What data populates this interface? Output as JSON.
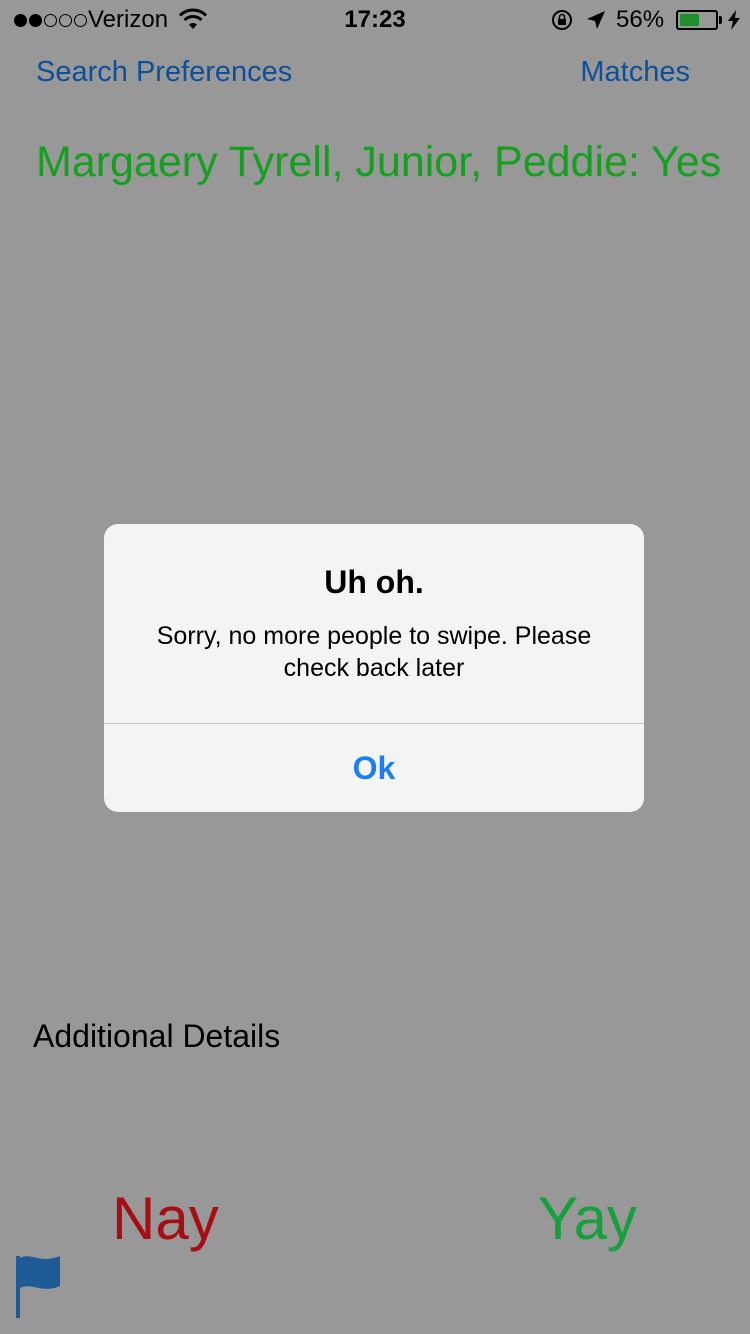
{
  "status_bar": {
    "signal_dots_filled": 2,
    "signal_dots_total": 5,
    "carrier": "Verizon",
    "time": "17:23",
    "battery_percent": "56%",
    "battery_level": 0.56,
    "battery_color": "#1f8f2b"
  },
  "nav": {
    "left_label": "Search Preferences",
    "right_label": "Matches",
    "link_color": "#0c4f9a"
  },
  "profile": {
    "title": "Margaery Tyrell, Junior, Peddie: Yes",
    "title_color": "#14a01e"
  },
  "details": {
    "label": "Additional Details"
  },
  "actions": {
    "nay_label": "Nay",
    "yay_label": "Yay",
    "nay_color": "#a80d13",
    "yay_color": "#14a03a"
  },
  "flag": {
    "icon": "flag-icon",
    "color": "#1e5b96"
  },
  "alert": {
    "title": "Uh oh.",
    "message": "Sorry, no more people to swipe. Please check back later",
    "button_label": "Ok",
    "button_color": "#1a7ff5"
  }
}
